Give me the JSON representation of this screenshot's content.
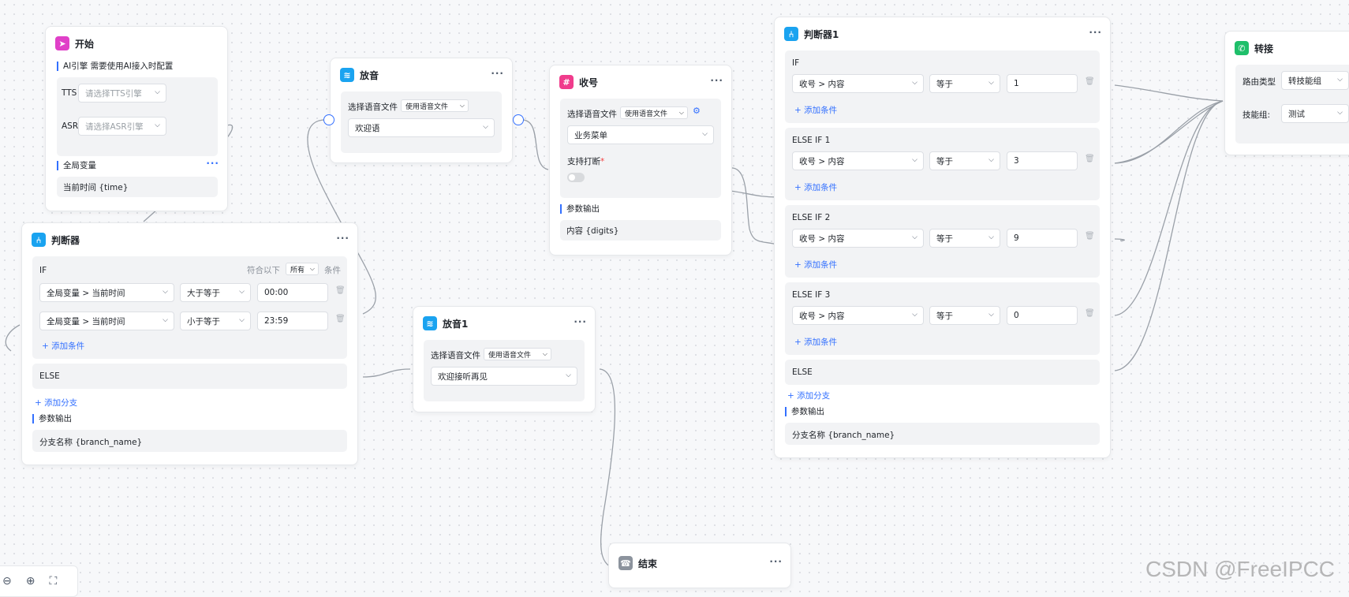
{
  "start": {
    "title": "开始",
    "ai_section": "AI引擎 需要使用AI接入时配置",
    "tts_label": "TTS",
    "tts_placeholder": "请选择TTS引擎",
    "asr_label": "ASR",
    "asr_placeholder": "请选择ASR引擎",
    "global_section": "全局变量",
    "global_value": "当前时间 {time}",
    "more": "···"
  },
  "play": {
    "title": "放音",
    "file_label": "选择语音文件",
    "file_mode": "使用语音文件",
    "file_value": "欢迎语",
    "more": "···"
  },
  "collect": {
    "title": "收号",
    "file_label": "选择语音文件",
    "file_mode": "使用语音文件",
    "menu_value": "业务菜单",
    "interrupt_label": "支持打断",
    "required": "*",
    "output_section": "参数输出",
    "output_value": "内容 {digits}",
    "more": "···"
  },
  "judge": {
    "title": "判断器",
    "if_label": "IF",
    "cond_prefix": "符合以下",
    "cond_mode": "所有",
    "cond_suffix": "条件",
    "rows": [
      {
        "var": "全局变量 > 当前时间",
        "op": "大于等于",
        "val": "00:00"
      },
      {
        "var": "全局变量 > 当前时间",
        "op": "小于等于",
        "val": "23:59"
      }
    ],
    "add_condition": "+ 添加条件",
    "else_label": "ELSE",
    "add_branch": "+ 添加分支",
    "output_section": "参数输出",
    "output_value": "分支名称 {branch_name}",
    "more": "···"
  },
  "play1": {
    "title": "放音1",
    "file_label": "选择语音文件",
    "file_mode": "使用语音文件",
    "file_value": "欢迎接听再见",
    "more": "···"
  },
  "end": {
    "title": "结束",
    "more": "···"
  },
  "judge1": {
    "title": "判断器1",
    "more": "···",
    "branches": [
      {
        "label": "IF",
        "var": "收号 > 内容",
        "op": "等于",
        "val": "1"
      },
      {
        "label": "ELSE IF 1",
        "var": "收号 > 内容",
        "op": "等于",
        "val": "3"
      },
      {
        "label": "ELSE IF 2",
        "var": "收号 > 内容",
        "op": "等于",
        "val": "9"
      },
      {
        "label": "ELSE IF 3",
        "var": "收号 > 内容",
        "op": "等于",
        "val": "0"
      }
    ],
    "add_condition": "+ 添加条件",
    "else_label": "ELSE",
    "add_branch": "+ 添加分支",
    "output_section": "参数输出",
    "output_value": "分支名称 {branch_name}"
  },
  "transfer": {
    "title": "转接",
    "route_label": "路由类型",
    "route_value": "转技能组",
    "skill_label": "技能组:",
    "skill_value": "测试"
  },
  "watermark": "CSDN @FreeIPCC",
  "colors": {
    "accent": "#3370ff",
    "start_icon": "#e040c8",
    "play_icon": "#1aa3f0",
    "collect_icon": "#f03c8c",
    "judge_icon": "#1aa3f0",
    "end_icon": "#8c939d",
    "transfer_icon": "#1fbf6a"
  }
}
